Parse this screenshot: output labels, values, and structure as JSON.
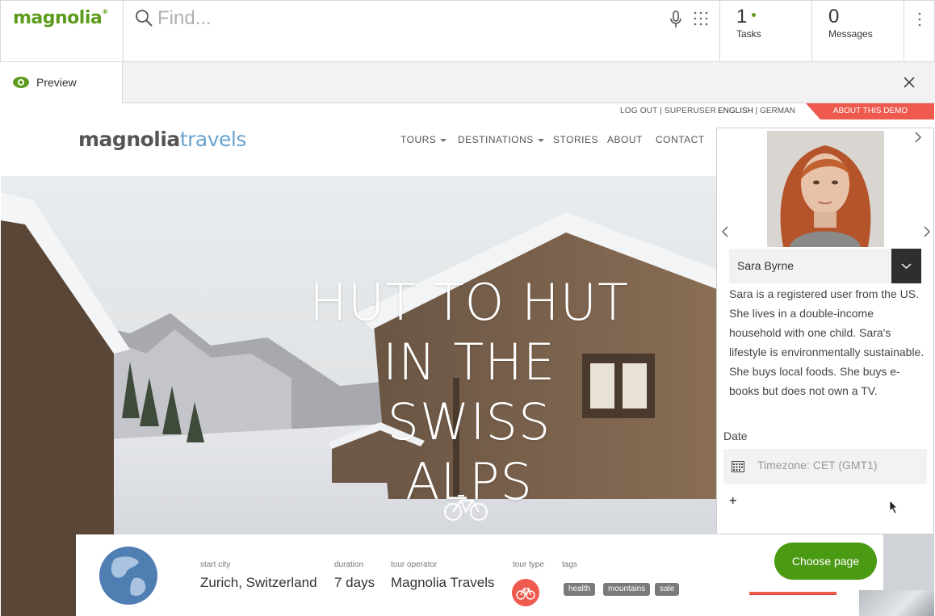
{
  "app": {
    "logo": "magnolia",
    "search_placeholder": "Find...",
    "tasks": {
      "count": "1",
      "label": "Tasks"
    },
    "messages": {
      "count": "0",
      "label": "Messages"
    }
  },
  "tab": {
    "label": "Preview"
  },
  "site": {
    "util": {
      "login": "LOG OUT | SUPERUSER",
      "lang_active": "ENGLISH",
      "lang_sep": " | ",
      "lang_other": "GERMAN",
      "about": "ABOUT THIS DEMO"
    },
    "logo_part1": "magnolia",
    "logo_part2": "travels",
    "nav": [
      "TOURS",
      "DESTINATIONS",
      "STORIES",
      "ABOUT",
      "CONTACT"
    ],
    "hero_title": [
      "HUT TO HUT",
      "IN THE SWISS",
      "ALPS"
    ],
    "info": {
      "start_city_label": "start city",
      "start_city": "Zurich, Switzerland",
      "duration_label": "duration",
      "duration": "7 days",
      "operator_label": "tour operator",
      "operator": "Magnolia Travels",
      "type_label": "tour type",
      "tags_label": "tags",
      "tags": [
        "health",
        "mountains",
        "sale"
      ]
    },
    "choose_page": "Choose page"
  },
  "persona": {
    "name": "Sara Byrne",
    "description": "Sara is a registered user from the US. She lives in a double-income household with one child. Sara's lifestyle is environmentally sustainable. She buys local foods. She buys e-books but does not own a TV.",
    "date_label": "Date",
    "timezone_placeholder": "Timezone: CET (GMT1)",
    "add_label": "+"
  },
  "colors": {
    "brand_green": "#5d9b1c",
    "accent_red": "#ef5a4f",
    "button_green": "#4b9a13"
  }
}
